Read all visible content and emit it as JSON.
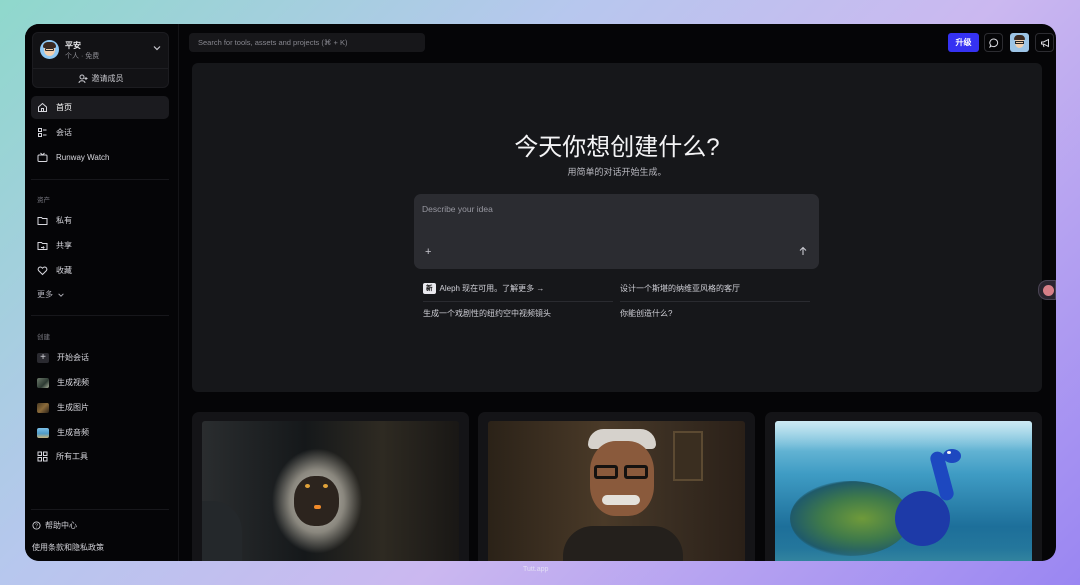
{
  "profile": {
    "name": "平安",
    "plan": "个人 · 免费",
    "invite_label": "邀请成员"
  },
  "nav": [
    {
      "label": "首页",
      "icon": "home-icon",
      "active": true
    },
    {
      "label": "会话",
      "icon": "sessions-icon"
    },
    {
      "label": "Runway Watch",
      "icon": "tv-icon"
    }
  ],
  "assets": {
    "section_label": "资产",
    "items": [
      {
        "label": "私有",
        "icon": "folder-icon"
      },
      {
        "label": "共享",
        "icon": "shared-folder-icon"
      },
      {
        "label": "收藏",
        "icon": "heart-icon"
      }
    ],
    "more_label": "更多"
  },
  "create": {
    "section_label": "创建",
    "items": [
      {
        "label": "开始会话",
        "icon": "plus-icon"
      },
      {
        "label": "生成视频",
        "icon": "video-thumb"
      },
      {
        "label": "生成图片",
        "icon": "image-thumb"
      },
      {
        "label": "生成音频",
        "icon": "audio-thumb"
      },
      {
        "label": "所有工具",
        "icon": "grid-icon"
      }
    ]
  },
  "footer": {
    "help_label": "帮助中心",
    "terms_label": "使用条款和隐私政策"
  },
  "topbar": {
    "search_placeholder": "Search for tools, assets and projects (⌘ + K)",
    "upgrade_label": "升级"
  },
  "hero": {
    "title": "今天你想创建什么?",
    "subtitle": "用简单的对话开始生成。",
    "prompt_placeholder": "Describe your idea",
    "plus": "+",
    "new_badge": "新",
    "suggestions": [
      "Aleph 现在可用。了解更多 →",
      "设计一个斯堪的纳维亚风格的客厅",
      "生成一个戏剧性的纽约空中视频镜头",
      "你能创造什么?"
    ]
  },
  "watermark": "Tutt.app",
  "colors": {
    "accent": "#3532f2",
    "window_bg": "#050507",
    "panel_bg": "#16171a"
  }
}
